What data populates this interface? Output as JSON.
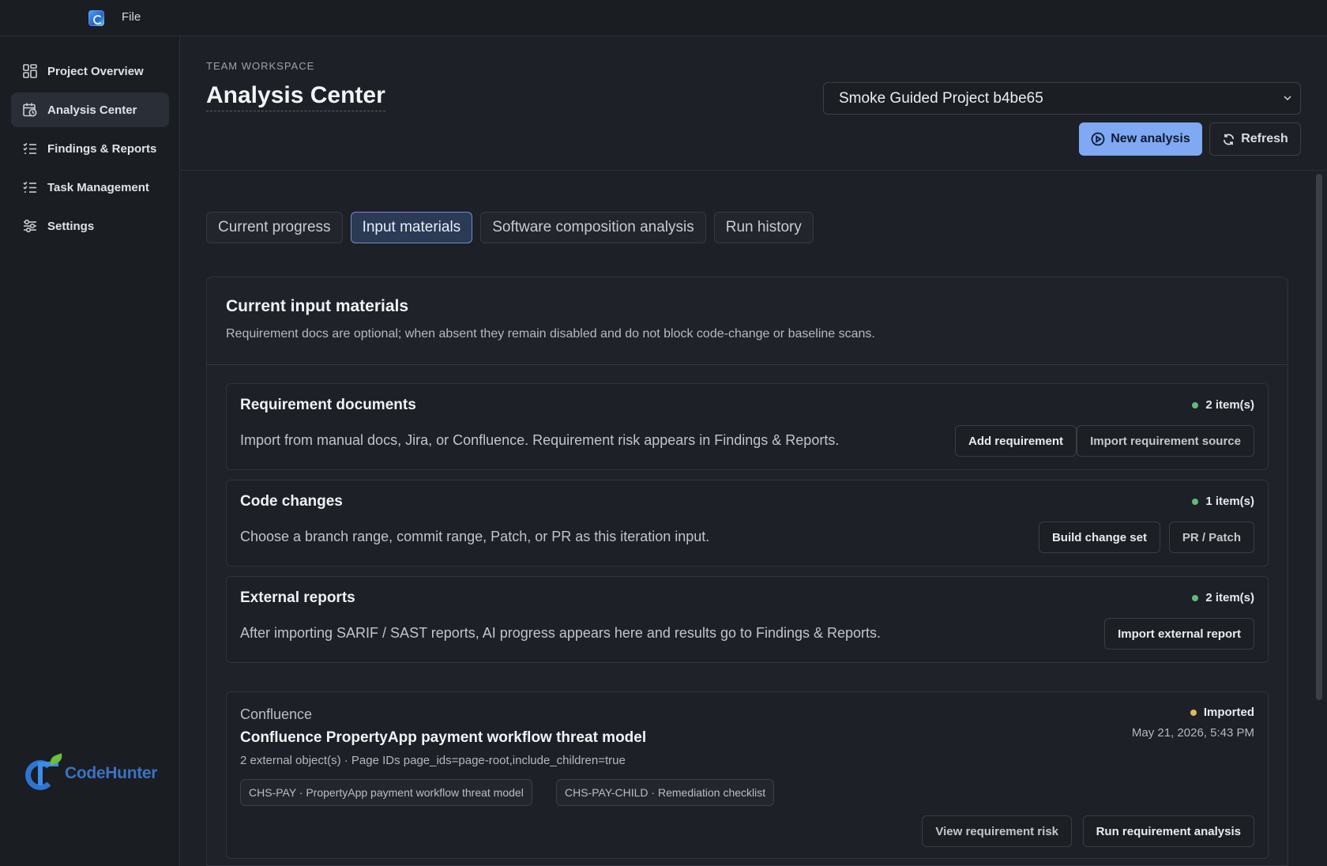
{
  "menubar": {
    "file_label": "File"
  },
  "sidebar": {
    "items": [
      {
        "label": "Project Overview",
        "icon": "grid-icon"
      },
      {
        "label": "Analysis Center",
        "icon": "calendar-clock-icon",
        "active": true
      },
      {
        "label": "Findings & Reports",
        "icon": "checklist-icon"
      },
      {
        "label": "Task Management",
        "icon": "checklist-icon"
      },
      {
        "label": "Settings",
        "icon": "sliders-icon"
      }
    ],
    "logo_text": "CodeHunter"
  },
  "header": {
    "eyebrow": "TEAM WORKSPACE",
    "title": "Analysis Center",
    "project_select": "Smoke Guided Project b4be65",
    "new_analysis_label": "New analysis",
    "refresh_label": "Refresh"
  },
  "tabs": [
    {
      "label": "Current progress"
    },
    {
      "label": "Input materials",
      "active": true
    },
    {
      "label": "Software composition analysis"
    },
    {
      "label": "Run history"
    }
  ],
  "card": {
    "title": "Current input materials",
    "subtitle": "Requirement docs are optional; when absent they remain disabled and do not block code-change or baseline scans."
  },
  "sections": {
    "requirements": {
      "title": "Requirement documents",
      "count": "2 item(s)",
      "description": "Import from manual docs, Jira, or Confluence. Requirement risk appears in Findings & Reports.",
      "add_label": "Add requirement",
      "import_label": "Import requirement source"
    },
    "code_changes": {
      "title": "Code changes",
      "count": "1 item(s)",
      "description": "Choose a branch range, commit range, Patch, or PR as this iteration input.",
      "build_label": "Build change set",
      "pr_label": "PR / Patch"
    },
    "external_reports": {
      "title": "External reports",
      "count": "2 item(s)",
      "description": "After importing SARIF / SAST reports, AI progress appears here and results go to Findings & Reports.",
      "import_label": "Import external report"
    }
  },
  "imported_item": {
    "source": "Confluence",
    "title": "Confluence PropertyApp payment workflow threat model",
    "meta": "2 external object(s) · Page IDs page_ids=page-root,include_children=true",
    "status": "Imported",
    "date": "May 21, 2026, 5:43 PM",
    "chips": [
      "CHS-PAY · PropertyApp payment workflow threat model",
      "CHS-PAY-CHILD · Remediation checklist"
    ],
    "view_label": "View requirement risk",
    "run_label": "Run requirement analysis"
  },
  "colors": {
    "accent": "#7fa9f2",
    "status_ok": "#5dbb7e",
    "status_imported": "#e0b45a"
  }
}
